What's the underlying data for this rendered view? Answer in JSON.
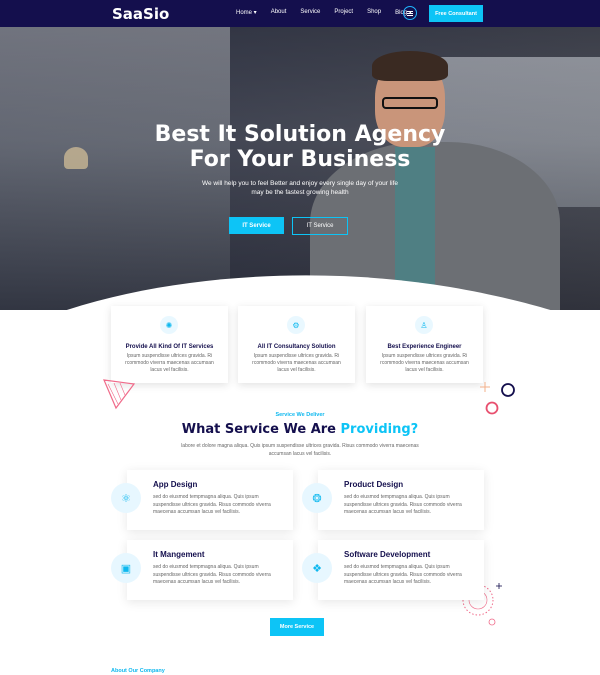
{
  "brand": {
    "logo": "SaaSio",
    "accent": "#0dc4f6",
    "navy": "#140f4d"
  },
  "nav": {
    "items": [
      "Home",
      "About",
      "Service",
      "Project",
      "Shop",
      "Blog"
    ],
    "cta": "Free Consultant"
  },
  "hero": {
    "title_line1": "Best It Solution Agency",
    "title_line2": "For Your Business",
    "subtitle_line1": "We will help you to feel Better and enjoy every single day of your life",
    "subtitle_line2": "may be the fastest growing health",
    "btn_primary": "IT Service",
    "btn_secondary": "IT Service"
  },
  "features": [
    {
      "title": "Provide All Kind Of IT Services",
      "desc": "Ipsum suspendisse ultrices gravida. Ri rcommodo viverra maecenas accumsan lacus vel facilisis.",
      "icon": "atom-icon"
    },
    {
      "title": "All IT Consultancy Solution",
      "desc": "Ipsum suspendisse ultrices gravida. Ri rcommodo viverra maecenas accumsan lacus vel facilisis.",
      "icon": "gear-icon"
    },
    {
      "title": "Best Experience Engineer",
      "desc": "Ipsum suspendisse ultrices gravida. Ri rcommodo viverra maecenas accumsan lacus vel facilisis.",
      "icon": "engineer-icon"
    }
  ],
  "services_section": {
    "kicker": "Service We Deliver",
    "title": "What Service We Are",
    "title_highlight": "Providing?",
    "desc": "labore et dolore magna aliqua. Quis ipsum suspendisse ultrices gravida. Risus commodo viverra maecenas accumsan lacus vel facilisis.",
    "items": [
      {
        "title": "App Design",
        "desc": "sed do eiusmod tempmagna aliqua. Quis ipsum suspendisse ultrices gravida. Risus commodo viverra maecenas accumsan lacus vel facilisis.",
        "icon": "app-design-icon"
      },
      {
        "title": "Product Design",
        "desc": "sed do eiusmod tempmagna aliqua. Quis ipsum suspendisse ultrices gravida. Risus commodo viverra maecenas accumsan lacus vel facilisis.",
        "icon": "product-design-icon"
      },
      {
        "title": "It Mangement",
        "desc": "sed do eiusmod tempmagna aliqua. Quis ipsum suspendisse ultrices gravida. Risus commodo viverra maecenas accumsan lacus vel facilisis.",
        "icon": "management-icon"
      },
      {
        "title": "Software Development",
        "desc": "sed do eiusmod tempmagna aliqua. Quis ipsum suspendisse ultrices gravida. Risus commodo viverra maecenas accumsan lacus vel facilisis.",
        "icon": "software-icon"
      }
    ],
    "more_btn": "More Service"
  },
  "about": {
    "kicker": "About Our Company"
  }
}
